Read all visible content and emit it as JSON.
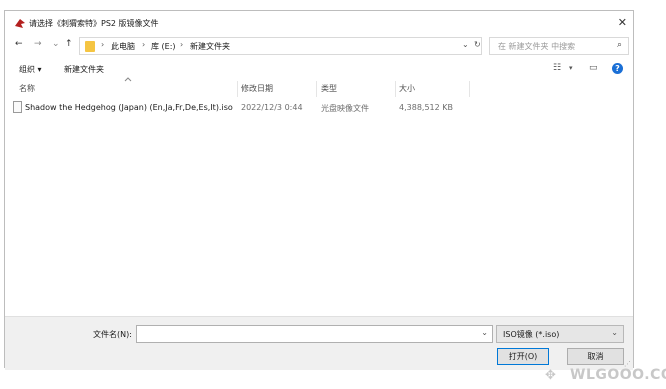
{
  "window": {
    "title": "请选择《刺猬索特》PS2 版镜像文件",
    "close_glyph": "✕"
  },
  "nav": {
    "back": "←",
    "forward": "→",
    "recent": "⌄",
    "up": "↑"
  },
  "address": {
    "crumbs": [
      "此电脑",
      "库 (E:)",
      "新建文件夹"
    ],
    "sep": "›",
    "dropdown": "⌄",
    "refresh": "↻"
  },
  "search": {
    "placeholder": "在 新建文件夹 中搜索",
    "icon": "⌕"
  },
  "toolbar": {
    "organize": "组织 ▾",
    "new_folder": "新建文件夹",
    "view_glyph": "☷",
    "view_drop": "▾",
    "pane_glyph": "▭",
    "help": "?"
  },
  "columns": {
    "name": "名称",
    "date": "修改日期",
    "type": "类型",
    "size": "大小"
  },
  "files": [
    {
      "name": "Shadow the Hedgehog (Japan) (En,Ja,Fr,De,Es,It).iso",
      "date": "2022/12/3 0:44",
      "type": "光盘映像文件",
      "size": "4,388,512 KB"
    }
  ],
  "footer": {
    "filename_label": "文件名(N):",
    "filename_value": "",
    "dropdown": "⌄",
    "filetype": "ISO镜像 (*.iso)",
    "open": "打开(O)",
    "cancel": "取消"
  },
  "watermark": {
    "text": "WLGOOO.COM",
    "icon": "✥"
  },
  "colors": {
    "accent": "#0078d7",
    "folder": "#f5c542",
    "help": "#1a6fd6"
  }
}
